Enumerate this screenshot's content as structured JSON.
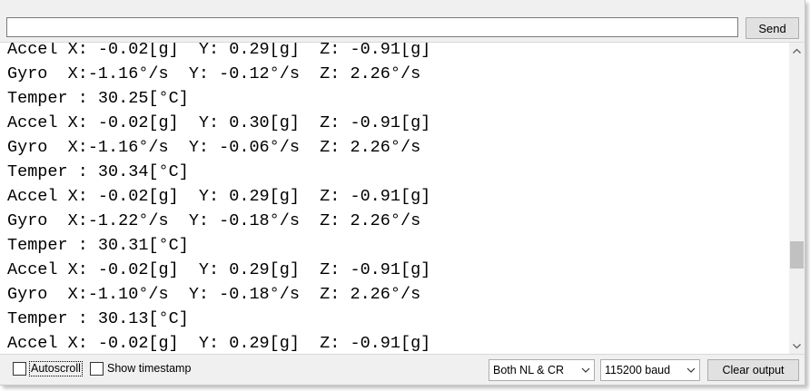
{
  "input_bar": {
    "input_value": "",
    "send_label": "Send"
  },
  "output": {
    "lines": [
      "Accel X: -0.02[g]  Y: 0.29[g]  Z: -0.91[g]",
      "Gyro  X:-1.16°/s  Y: -0.12°/s  Z: 2.26°/s",
      "Temper : 30.25[°C]",
      "Accel X: -0.02[g]  Y: 0.30[g]  Z: -0.91[g]",
      "Gyro  X:-1.16°/s  Y: -0.06°/s  Z: 2.26°/s",
      "Temper : 30.34[°C]",
      "Accel X: -0.02[g]  Y: 0.29[g]  Z: -0.91[g]",
      "Gyro  X:-1.22°/s  Y: -0.18°/s  Z: 2.26°/s",
      "Temper : 30.31[°C]",
      "Accel X: -0.02[g]  Y: 0.29[g]  Z: -0.91[g]",
      "Gyro  X:-1.10°/s  Y: -0.18°/s  Z: 2.26°/s",
      "Temper : 30.13[°C]",
      "Accel X: -0.02[g]  Y: 0.29[g]  Z: -0.91[g]"
    ],
    "scroll_icons": {
      "up": "chevron-up-icon",
      "down": "chevron-down-icon"
    }
  },
  "bottom_bar": {
    "autoscroll_label": "Autoscroll",
    "autoscroll_checked": false,
    "timestamp_label": "Show timestamp",
    "timestamp_checked": false,
    "line_ending_selected": "Both NL & CR",
    "baud_selected": "115200 baud",
    "clear_label": "Clear output"
  },
  "colors": {
    "window_bg": "#f0f0f0",
    "output_bg": "#ffffff",
    "button_bg": "#e1e1e1",
    "scroll_thumb": "#c1c1c1"
  }
}
